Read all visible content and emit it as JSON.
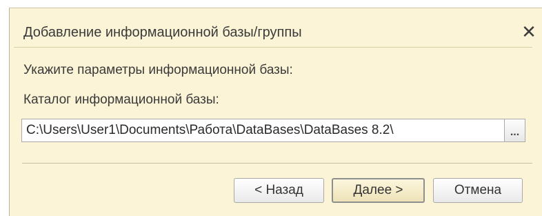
{
  "window": {
    "title": "Добавление информационной базы/группы",
    "close_glyph": "✕"
  },
  "main": {
    "heading": "Укажите параметры информационной базы:",
    "catalog_label": "Каталог информационной базы:",
    "catalog_value": "C:\\Users\\User1\\Documents\\Работа\\DataBases\\DataBases 8.2\\",
    "browse_label": "..."
  },
  "buttons": {
    "back": "< Назад",
    "next": "Далее >",
    "cancel": "Отмена"
  },
  "colors": {
    "dialog_background": "#fbf4d6",
    "default_button": "#ede2b8"
  }
}
